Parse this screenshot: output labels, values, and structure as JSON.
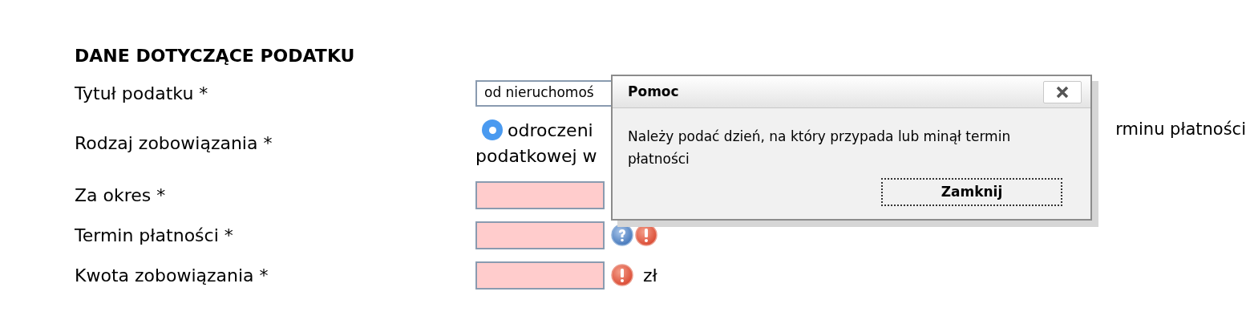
{
  "section_title": "DANE DOTYCZĄCE PODATKU",
  "fields": [
    {
      "kind": "select",
      "label": "Tytuł podatku *",
      "value": "od nieruchomoś"
    },
    {
      "kind": "radio",
      "label": "Rodzaj zobowiązania *",
      "selected": true,
      "visible_text": [
        "odroczeni",
        "rminu płatności",
        "podatkowej w"
      ]
    },
    {
      "kind": "text",
      "label": "Za okres *",
      "invalid": true,
      "help_icon": false,
      "error_icon": false
    },
    {
      "kind": "text",
      "label": "Termin płatności *",
      "invalid": true,
      "help_icon": true,
      "error_icon": true
    },
    {
      "kind": "text",
      "label": "Kwota zobowiązania *",
      "invalid": true,
      "help_icon": false,
      "error_icon": true,
      "unit": "zł"
    }
  ],
  "dialog": {
    "title": "Pomoc",
    "message": "Należy podać dzień, na który przypada lub minął termin płatności",
    "button": "Zamknij"
  }
}
